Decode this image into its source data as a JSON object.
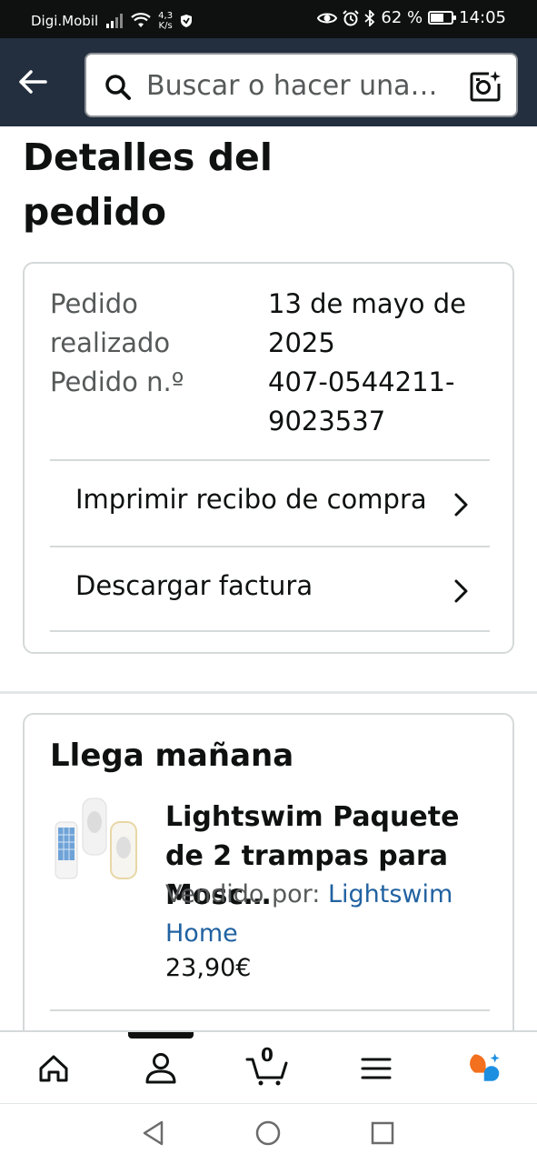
{
  "status_bar": {
    "carrier": "Digi.Mobil",
    "speed_value": "4,3",
    "speed_unit": "K/s",
    "battery": "62 %",
    "battery_level": 0.62,
    "time": "14:05"
  },
  "search": {
    "placeholder": "Buscar o hacer una…"
  },
  "page": {
    "title": "Detalles del pedido"
  },
  "order": {
    "placed_label": "Pedido realizado",
    "placed_value": "13 de mayo de 2025",
    "number_label": "Pedido n.º",
    "number_value": "407-0544211-9023537",
    "links": [
      {
        "label": "Imprimir recibo de compra"
      },
      {
        "label": "Descargar factura"
      }
    ]
  },
  "delivery": {
    "heading": "Llega mañana",
    "product": {
      "title": "Lightswim Paquete de 2 trampas para Mosc…",
      "sold_by_label": "Vendido por:",
      "seller": "Lightswim Home",
      "price": "23,90€"
    }
  },
  "bottom_nav": {
    "cart_count": "0",
    "items": [
      "home-icon",
      "account-icon",
      "cart-icon",
      "menu-icon",
      "rufus-icon"
    ]
  },
  "colors": {
    "header_bg": "#232f3e",
    "link": "#2162a1",
    "border": "#d5d9d9",
    "rufus_orange": "#f3701e",
    "rufus_blue": "#1d8fe1"
  }
}
